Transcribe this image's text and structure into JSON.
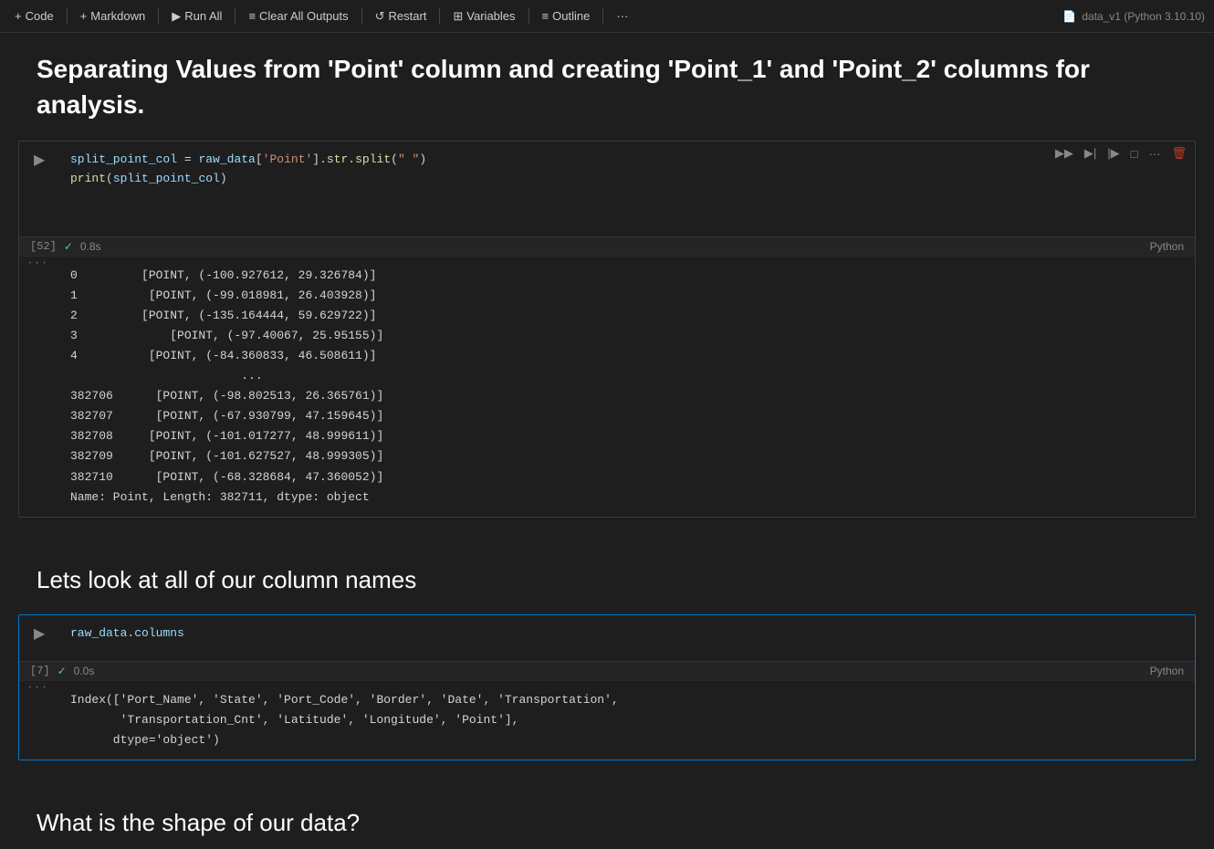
{
  "toolbar": {
    "code_label": "Code",
    "markdown_label": "Markdown",
    "run_all_label": "Run All",
    "clear_all_label": "Clear All Outputs",
    "restart_label": "Restart",
    "variables_label": "Variables",
    "outline_label": "Outline",
    "more_label": "···",
    "kernel_info": "data_v1 (Python 3.10.10)"
  },
  "cell1": {
    "markdown_heading": "Separating Values from 'Point' column and creating 'Point_1' and 'Point_2' columns for analysis."
  },
  "cell2": {
    "number": "[52]",
    "exec_time": "0.8s",
    "lang": "Python",
    "code_line1": "split_point_col = raw_data['Point'].str.split(\" \")",
    "code_line2": "print(split_point_col)",
    "output": "0         [POINT, (-100.927612, 29.326784)]\n1          [POINT, (-99.018981, 26.403928)]\n2         [POINT, (-135.164444, 59.629722)]\n3             [POINT, (-97.40067, 25.95155)]\n4          [POINT, (-84.360833, 46.508611)]\n                        ...\n382706      [POINT, (-98.802513, 26.365761)]\n382707      [POINT, (-67.930799, 47.159645)]\n382708     [POINT, (-101.017277, 48.999611)]\n382709     [POINT, (-101.627527, 48.999305)]\n382710      [POINT, (-68.328684, 47.360052)]\nName: Point, Length: 382711, dtype: object"
  },
  "cell3_heading": "Lets look at all of our column names",
  "cell4": {
    "number": "[7]",
    "exec_time": "0.0s",
    "lang": "Python",
    "code": "raw_data.columns",
    "output": "Index(['Port_Name', 'State', 'Port_Code', 'Border', 'Date', 'Transportation',\n       'Transportation_Cnt', 'Latitude', 'Longitude', 'Point'],\n      dtype='object')"
  },
  "cell5_heading": "What is the shape of our data?",
  "icons": {
    "run": "▶",
    "run_all": "▶",
    "clear": "≡",
    "restart": "↺",
    "variables": "⊞",
    "outline": "≡",
    "add": "+",
    "execute_run": "▶",
    "fast_forward": "▶▶",
    "step": "▶|",
    "stop": "□",
    "more_vert": "···",
    "trash": "🗑",
    "check": "✓"
  }
}
